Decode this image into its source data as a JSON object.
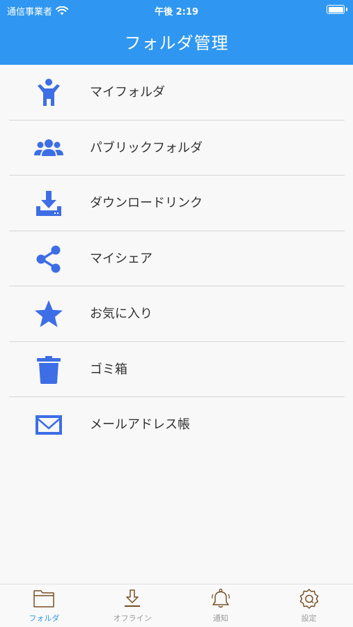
{
  "status": {
    "carrier": "通信事業者",
    "time": "午後 2:19",
    "battery_level": 1.0
  },
  "header": {
    "title": "フォルダ管理"
  },
  "colors": {
    "header": "#2f97f1",
    "icon": "#3d6ee6",
    "tab_icon": "#7a4f23",
    "tab_active_label": "#2f97f1"
  },
  "list": {
    "items": [
      {
        "label": "マイフォルダ",
        "icon": "person-icon"
      },
      {
        "label": "パブリックフォルダ",
        "icon": "group-icon"
      },
      {
        "label": "ダウンロードリンク",
        "icon": "download-icon"
      },
      {
        "label": "マイシェア",
        "icon": "share-icon"
      },
      {
        "label": "お気に入り",
        "icon": "star-icon"
      },
      {
        "label": "ゴミ箱",
        "icon": "trash-icon"
      },
      {
        "label": "メールアドレス帳",
        "icon": "mail-icon"
      }
    ]
  },
  "tabs": [
    {
      "label": "フォルダ",
      "icon": "folder-icon",
      "active": true
    },
    {
      "label": "オフライン",
      "icon": "download-icon",
      "active": false
    },
    {
      "label": "通知",
      "icon": "bell-icon",
      "active": false
    },
    {
      "label": "設定",
      "icon": "gear-icon",
      "active": false
    }
  ]
}
